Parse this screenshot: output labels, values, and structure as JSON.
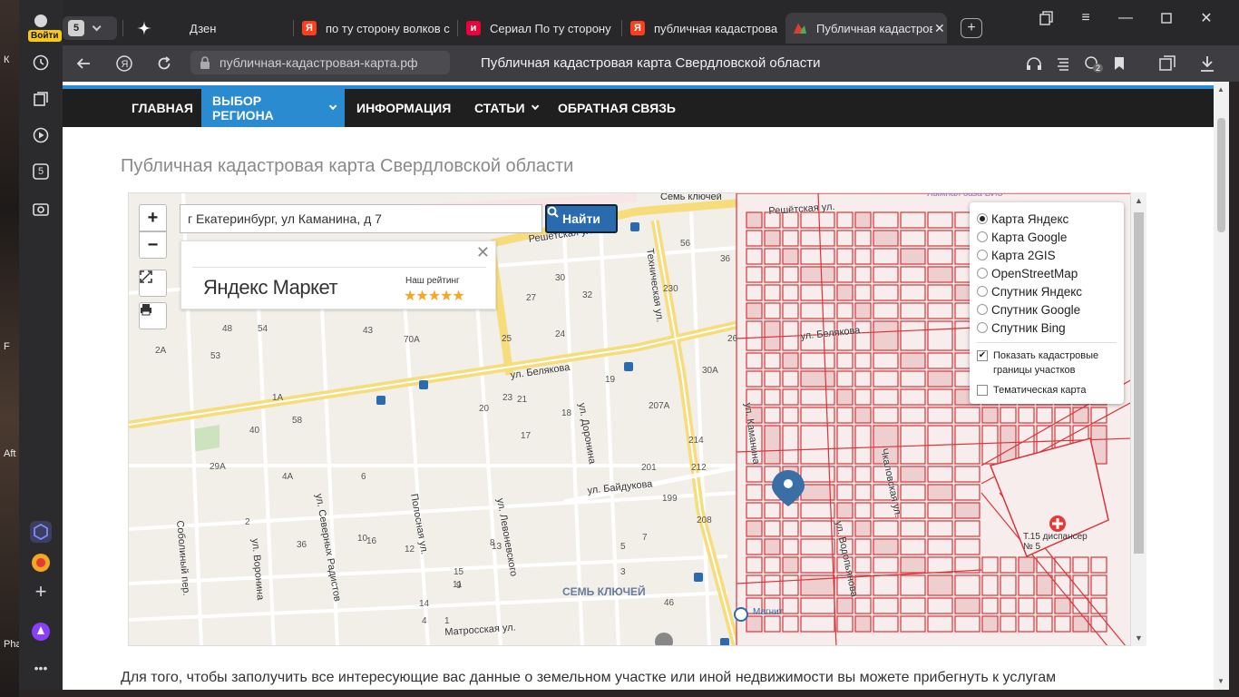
{
  "desktop": {
    "labels": [
      "К",
      "Aft",
      "F",
      "Pha"
    ]
  },
  "sidebar": {
    "login_label": "Войти",
    "tab_count": "5"
  },
  "tabs": [
    {
      "title": "Дзен",
      "favicon": "dzen"
    },
    {
      "title": "по ту сторону волков с",
      "favicon": "yandex"
    },
    {
      "title": "Сериал По ту сторону",
      "favicon": "ivi"
    },
    {
      "title": "публичная кадастрова",
      "favicon": "yandex"
    },
    {
      "title": "Публичная кадастрова",
      "favicon": "cadastral"
    }
  ],
  "tab_counter": "5",
  "address": {
    "url": "публичная-кадастровая-карта.рф",
    "page_title": "Публичная кадастровая карта Свердловской области",
    "downloads_badge": "2"
  },
  "nav": {
    "items": [
      "ГЛАВНАЯ",
      "ВЫБОР РЕГИОНА",
      "ИНФОРМАЦИЯ",
      "СТАТЬИ",
      "ОБРАТНАЯ СВЯЗЬ"
    ],
    "active": "ВЫБОР РЕГИОНА"
  },
  "page": {
    "heading": "Публичная кадастровая карта Свердловской области",
    "body_text": "Для того, чтобы заполучить все интересующие вас данные о земельном участке или иной недвижимости вы можете прибегнуть к услугам"
  },
  "map": {
    "search_value": "г Екатеринбург, ул Каманина, д 7",
    "find_label": "Найти",
    "zoom_in": "+",
    "zoom_out": "−",
    "ad": {
      "brand": "Яндекс Маркет",
      "rating_label": "Наш рейтинг",
      "stars": "★★★★★"
    },
    "layers": [
      "Карта Яндекс",
      "Карта Google",
      "Карта 2GIS",
      "OpenStreetMap",
      "Спутник Яндекс",
      "Спутник Google",
      "Спутник Bing"
    ],
    "selected_layer": "Карта Яндекс",
    "checkboxes": [
      {
        "label": "Показать кадастровые границы участков",
        "checked": true
      },
      {
        "label": "Тематическая карта",
        "checked": false
      }
    ],
    "streets": [
      "Решётская ул.",
      "ул. Белякова",
      "ул. Байдукова",
      "Техническая ул.",
      "ул. Северных Радистов",
      "ул. Доронина",
      "ул. Левоневского",
      "Полосная ул.",
      "ул. Воронина",
      "Соболиный пер.",
      "Матросская ул.",
      "ул. Каманина",
      "ул. Водопьянова",
      "Чкаловская ул.",
      "ул. Белякова",
      "Решётская ул."
    ],
    "places": [
      "Семь ключей",
      "СЕМЬ КЛЮЧЕЙ",
      "Т.15 диспансер № 5",
      "Магнит",
      "Лыжная база ВИЗ"
    ],
    "house_numbers": [
      "56",
      "36",
      "30",
      "32",
      "27",
      "230",
      "26",
      "25",
      "24",
      "23",
      "30A",
      "21",
      "19",
      "20",
      "17",
      "18",
      "207A",
      "214",
      "201",
      "212",
      "199",
      "208",
      "5",
      "3",
      "7",
      "46",
      "54",
      "48",
      "43",
      "70A",
      "53",
      "2A",
      "1A",
      "58",
      "40",
      "29A",
      "4A",
      "36",
      "2",
      "6",
      "10",
      "16",
      "13",
      "14",
      "15",
      "11",
      "12",
      "4",
      "9",
      "1",
      "8"
    ]
  },
  "colors": {
    "accent": "#2a8bd0",
    "nav_bg": "#1f1f1f",
    "map_bg": "#f2efe9",
    "cadastral_line": "#d9343a",
    "road": "#f7e08c"
  }
}
